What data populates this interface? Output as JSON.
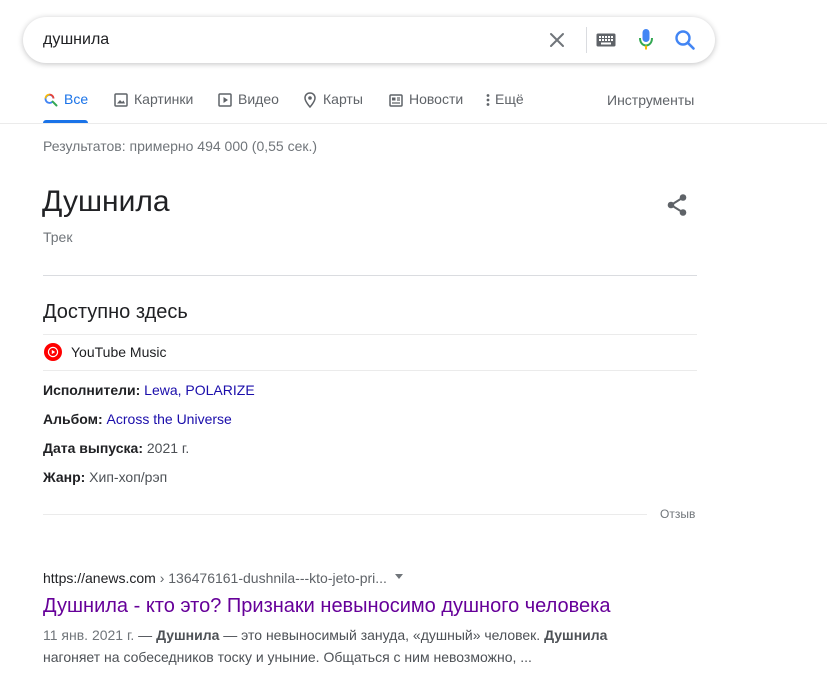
{
  "search": {
    "query": "душнила"
  },
  "tabs": [
    {
      "label": "Все",
      "icon": "search-icon",
      "active": true
    },
    {
      "label": "Картинки",
      "icon": "image-icon"
    },
    {
      "label": "Видео",
      "icon": "video-icon"
    },
    {
      "label": "Карты",
      "icon": "map-pin-icon"
    },
    {
      "label": "Новости",
      "icon": "news-icon"
    },
    {
      "label": "Ещё",
      "icon": "more-vert-icon"
    }
  ],
  "tools_label": "Инструменты",
  "stats": "Результатов: примерно 494 000 (0,55 сек.)",
  "knowledge_panel": {
    "title": "Душнила",
    "subtitle": "Трек",
    "available_title": "Доступно здесь",
    "provider": "YouTube Music",
    "facts": [
      {
        "label": "Исполнители:",
        "links": [
          "Lewa",
          "POLARIZE"
        ],
        "separator": ", "
      },
      {
        "label": "Альбом:",
        "links": [
          "Across the Universe"
        ]
      },
      {
        "label": "Дата выпуска:",
        "value": "2021 г."
      },
      {
        "label": "Жанр:",
        "value": "Хип-хоп/рэп"
      }
    ],
    "feedback": "Отзыв"
  },
  "result": {
    "domain": "https://anews.com",
    "path": " › 136476161-dushnila---kto-jeto-pri...",
    "title": "Душнила - кто это? Признаки невыносимо душного человека",
    "date": "11 янв. 2021 г.",
    "dash": " — ",
    "snippet_bold_1": "Душнила",
    "snippet_1": " — это невыносимый зануда, «душный» человек. ",
    "snippet_bold_2": "Душнила",
    "snippet_2": " нагоняет на собеседников тоску и уныние. Общаться с ним невозможно, ..."
  },
  "colors": {
    "accent": "#1a73e8",
    "link": "#1a0dab",
    "visited": "#660099",
    "youtube_red": "#ff0000"
  }
}
